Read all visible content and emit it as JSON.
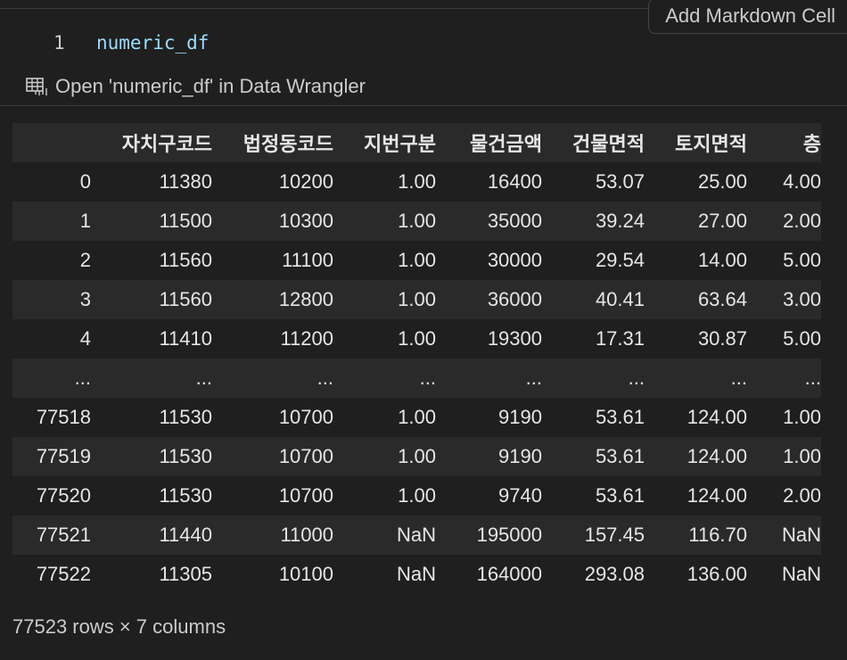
{
  "toolbar": {
    "add_markdown_label": "Add Markdown Cell"
  },
  "cell": {
    "line_number": "1",
    "code": "numeric_df",
    "wrangler_link": "Open 'numeric_df' in Data Wrangler",
    "wrangler_icon": "table-grid-icon"
  },
  "dataframe": {
    "columns": [
      "",
      "자치구코드",
      "법정동코드",
      "지번구분",
      "물건금액",
      "건물면적",
      "토지면적",
      "층"
    ],
    "rows": [
      [
        "0",
        "11380",
        "10200",
        "1.00",
        "16400",
        "53.07",
        "25.00",
        "4.00"
      ],
      [
        "1",
        "11500",
        "10300",
        "1.00",
        "35000",
        "39.24",
        "27.00",
        "2.00"
      ],
      [
        "2",
        "11560",
        "11100",
        "1.00",
        "30000",
        "29.54",
        "14.00",
        "5.00"
      ],
      [
        "3",
        "11560",
        "12800",
        "1.00",
        "36000",
        "40.41",
        "63.64",
        "3.00"
      ],
      [
        "4",
        "11410",
        "11200",
        "1.00",
        "19300",
        "17.31",
        "30.87",
        "5.00"
      ],
      [
        "...",
        "...",
        "...",
        "...",
        "...",
        "...",
        "...",
        "..."
      ],
      [
        "77518",
        "11530",
        "10700",
        "1.00",
        "9190",
        "53.61",
        "124.00",
        "1.00"
      ],
      [
        "77519",
        "11530",
        "10700",
        "1.00",
        "9190",
        "53.61",
        "124.00",
        "1.00"
      ],
      [
        "77520",
        "11530",
        "10700",
        "1.00",
        "9740",
        "53.61",
        "124.00",
        "2.00"
      ],
      [
        "77521",
        "11440",
        "11000",
        "NaN",
        "195000",
        "157.45",
        "116.70",
        "NaN"
      ],
      [
        "77522",
        "11305",
        "10100",
        "NaN",
        "164000",
        "293.08",
        "136.00",
        "NaN"
      ]
    ],
    "shape_text": "77523 rows × 7 columns"
  }
}
